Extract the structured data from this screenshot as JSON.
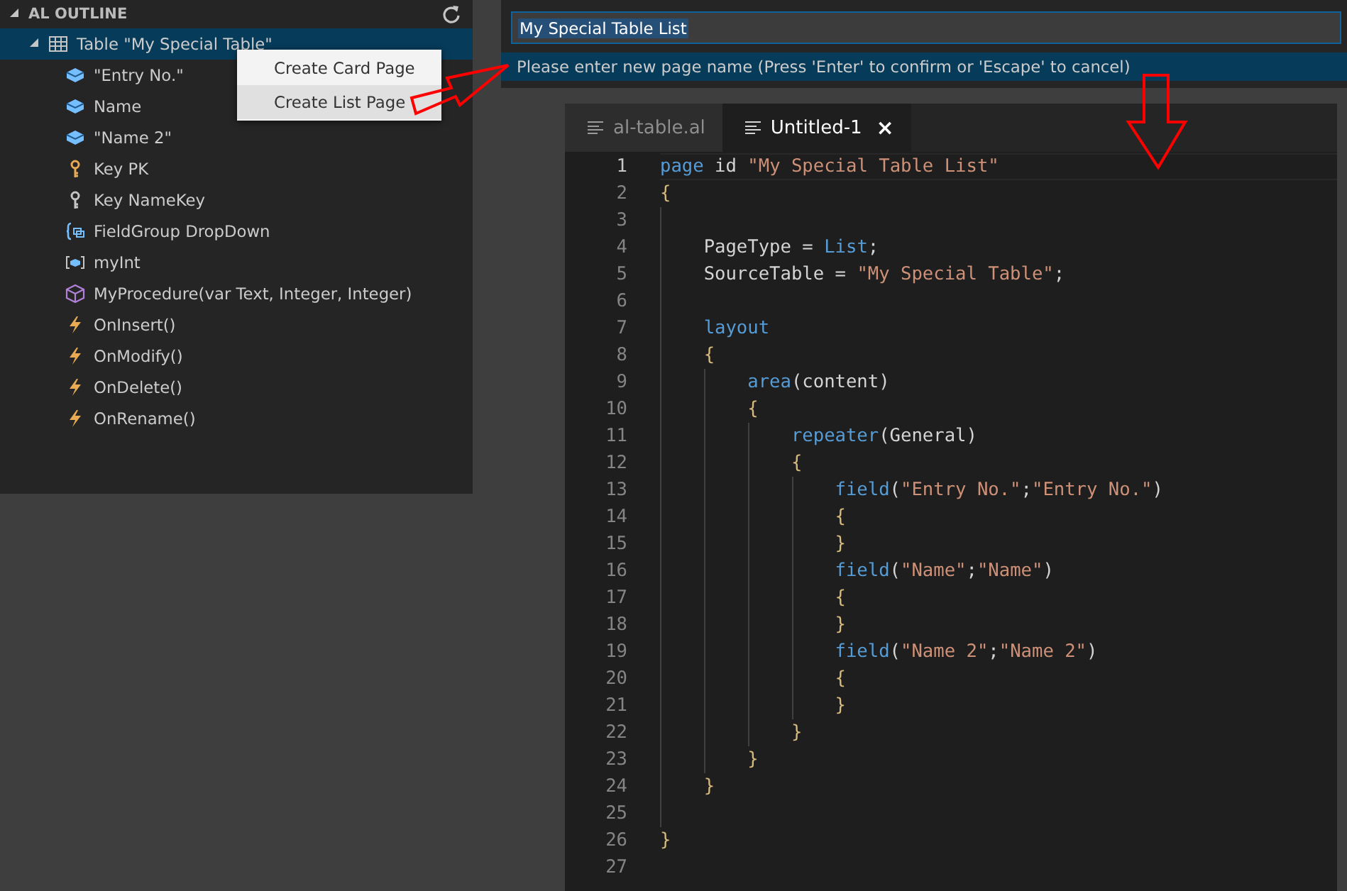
{
  "outline": {
    "title": "AL OUTLINE",
    "tree": [
      {
        "label": "Table \"My Special Table\"",
        "kind": "table",
        "expanded": true,
        "selected": true,
        "children": [
          {
            "label": "\"Entry No.\"",
            "kind": "field"
          },
          {
            "label": "Name",
            "kind": "field"
          },
          {
            "label": "\"Name 2\"",
            "kind": "field"
          },
          {
            "label": "Key PK",
            "kind": "primary-key"
          },
          {
            "label": "Key NameKey",
            "kind": "key"
          },
          {
            "label": "FieldGroup DropDown",
            "kind": "fieldgroup"
          },
          {
            "label": "myInt",
            "kind": "variable"
          },
          {
            "label": "MyProcedure(var Text, Integer, Integer)",
            "kind": "method"
          },
          {
            "label": "OnInsert()",
            "kind": "trigger"
          },
          {
            "label": "OnModify()",
            "kind": "trigger"
          },
          {
            "label": "OnDelete()",
            "kind": "trigger"
          },
          {
            "label": "OnRename()",
            "kind": "trigger"
          }
        ]
      }
    ]
  },
  "context_menu": {
    "items": [
      {
        "label": "Create Card Page",
        "selected": false
      },
      {
        "label": "Create List Page",
        "selected": true
      }
    ]
  },
  "quick_input": {
    "value": "My Special Table List",
    "message": "Please enter new page name (Press 'Enter' to confirm or 'Escape' to cancel)"
  },
  "editor": {
    "tabs": [
      {
        "label": "al-table.al",
        "selected": false
      },
      {
        "label": "Untitled-1",
        "selected": true,
        "close": "×"
      }
    ],
    "lines": [
      {
        "number": "1",
        "tokens": [
          {
            "kind": "keyword",
            "text": "page"
          },
          {
            "kind": "plain",
            "text": " id "
          },
          {
            "kind": "string",
            "text": "\"My Special Table List\""
          }
        ]
      },
      {
        "number": "2",
        "tokens": [
          {
            "kind": "brace",
            "text": "{"
          }
        ]
      },
      {
        "number": "3"
      },
      {
        "number": "4",
        "tokens": [
          {
            "kind": "plain",
            "text": "    PageType = "
          },
          {
            "kind": "keyword",
            "text": "List"
          },
          {
            "kind": "plain",
            "text": ";"
          }
        ]
      },
      {
        "number": "5",
        "tokens": [
          {
            "kind": "plain",
            "text": "    SourceTable = "
          },
          {
            "kind": "string",
            "text": "\"My Special Table\""
          },
          {
            "kind": "plain",
            "text": ";"
          }
        ]
      },
      {
        "number": "6"
      },
      {
        "number": "7",
        "tokens": [
          {
            "kind": "keyword",
            "text": "    layout"
          }
        ]
      },
      {
        "number": "8",
        "tokens": [
          {
            "kind": "brace",
            "text": "    {"
          }
        ]
      },
      {
        "number": "9",
        "tokens": [
          {
            "kind": "keyword",
            "text": "        area"
          },
          {
            "kind": "plain",
            "text": "(content)"
          }
        ]
      },
      {
        "number": "10",
        "tokens": [
          {
            "kind": "brace",
            "text": "        {"
          }
        ]
      },
      {
        "number": "11",
        "tokens": [
          {
            "kind": "keyword",
            "text": "            repeater"
          },
          {
            "kind": "plain",
            "text": "(General)"
          }
        ]
      },
      {
        "number": "12",
        "tokens": [
          {
            "kind": "brace",
            "text": "            {"
          }
        ]
      },
      {
        "number": "13",
        "tokens": [
          {
            "kind": "keyword",
            "text": "                field"
          },
          {
            "kind": "plain",
            "text": "("
          },
          {
            "kind": "string",
            "text": "\"Entry No.\""
          },
          {
            "kind": "plain",
            "text": ";"
          },
          {
            "kind": "string",
            "text": "\"Entry No.\""
          },
          {
            "kind": "plain",
            "text": ")"
          }
        ]
      },
      {
        "number": "14",
        "tokens": [
          {
            "kind": "brace",
            "text": "                {"
          }
        ]
      },
      {
        "number": "15",
        "tokens": [
          {
            "kind": "brace",
            "text": "                }"
          }
        ]
      },
      {
        "number": "16",
        "tokens": [
          {
            "kind": "keyword",
            "text": "                field"
          },
          {
            "kind": "plain",
            "text": "("
          },
          {
            "kind": "string",
            "text": "\"Name\""
          },
          {
            "kind": "plain",
            "text": ";"
          },
          {
            "kind": "string",
            "text": "\"Name\""
          },
          {
            "kind": "plain",
            "text": ")"
          }
        ]
      },
      {
        "number": "17",
        "tokens": [
          {
            "kind": "brace",
            "text": "                {"
          }
        ]
      },
      {
        "number": "18",
        "tokens": [
          {
            "kind": "brace",
            "text": "                }"
          }
        ]
      },
      {
        "number": "19",
        "tokens": [
          {
            "kind": "keyword",
            "text": "                field"
          },
          {
            "kind": "plain",
            "text": "("
          },
          {
            "kind": "string",
            "text": "\"Name 2\""
          },
          {
            "kind": "plain",
            "text": ";"
          },
          {
            "kind": "string",
            "text": "\"Name 2\""
          },
          {
            "kind": "plain",
            "text": ")"
          }
        ]
      },
      {
        "number": "20",
        "tokens": [
          {
            "kind": "brace",
            "text": "                {"
          }
        ]
      },
      {
        "number": "21",
        "tokens": [
          {
            "kind": "brace",
            "text": "                }"
          }
        ]
      },
      {
        "number": "22",
        "tokens": [
          {
            "kind": "brace",
            "text": "            }"
          }
        ]
      },
      {
        "number": "23",
        "tokens": [
          {
            "kind": "brace",
            "text": "        }"
          }
        ]
      },
      {
        "number": "24",
        "tokens": [
          {
            "kind": "brace",
            "text": "    }"
          }
        ]
      },
      {
        "number": "25"
      },
      {
        "number": "26",
        "tokens": [
          {
            "kind": "brace",
            "text": "}"
          }
        ]
      },
      {
        "number": "27"
      }
    ]
  }
}
